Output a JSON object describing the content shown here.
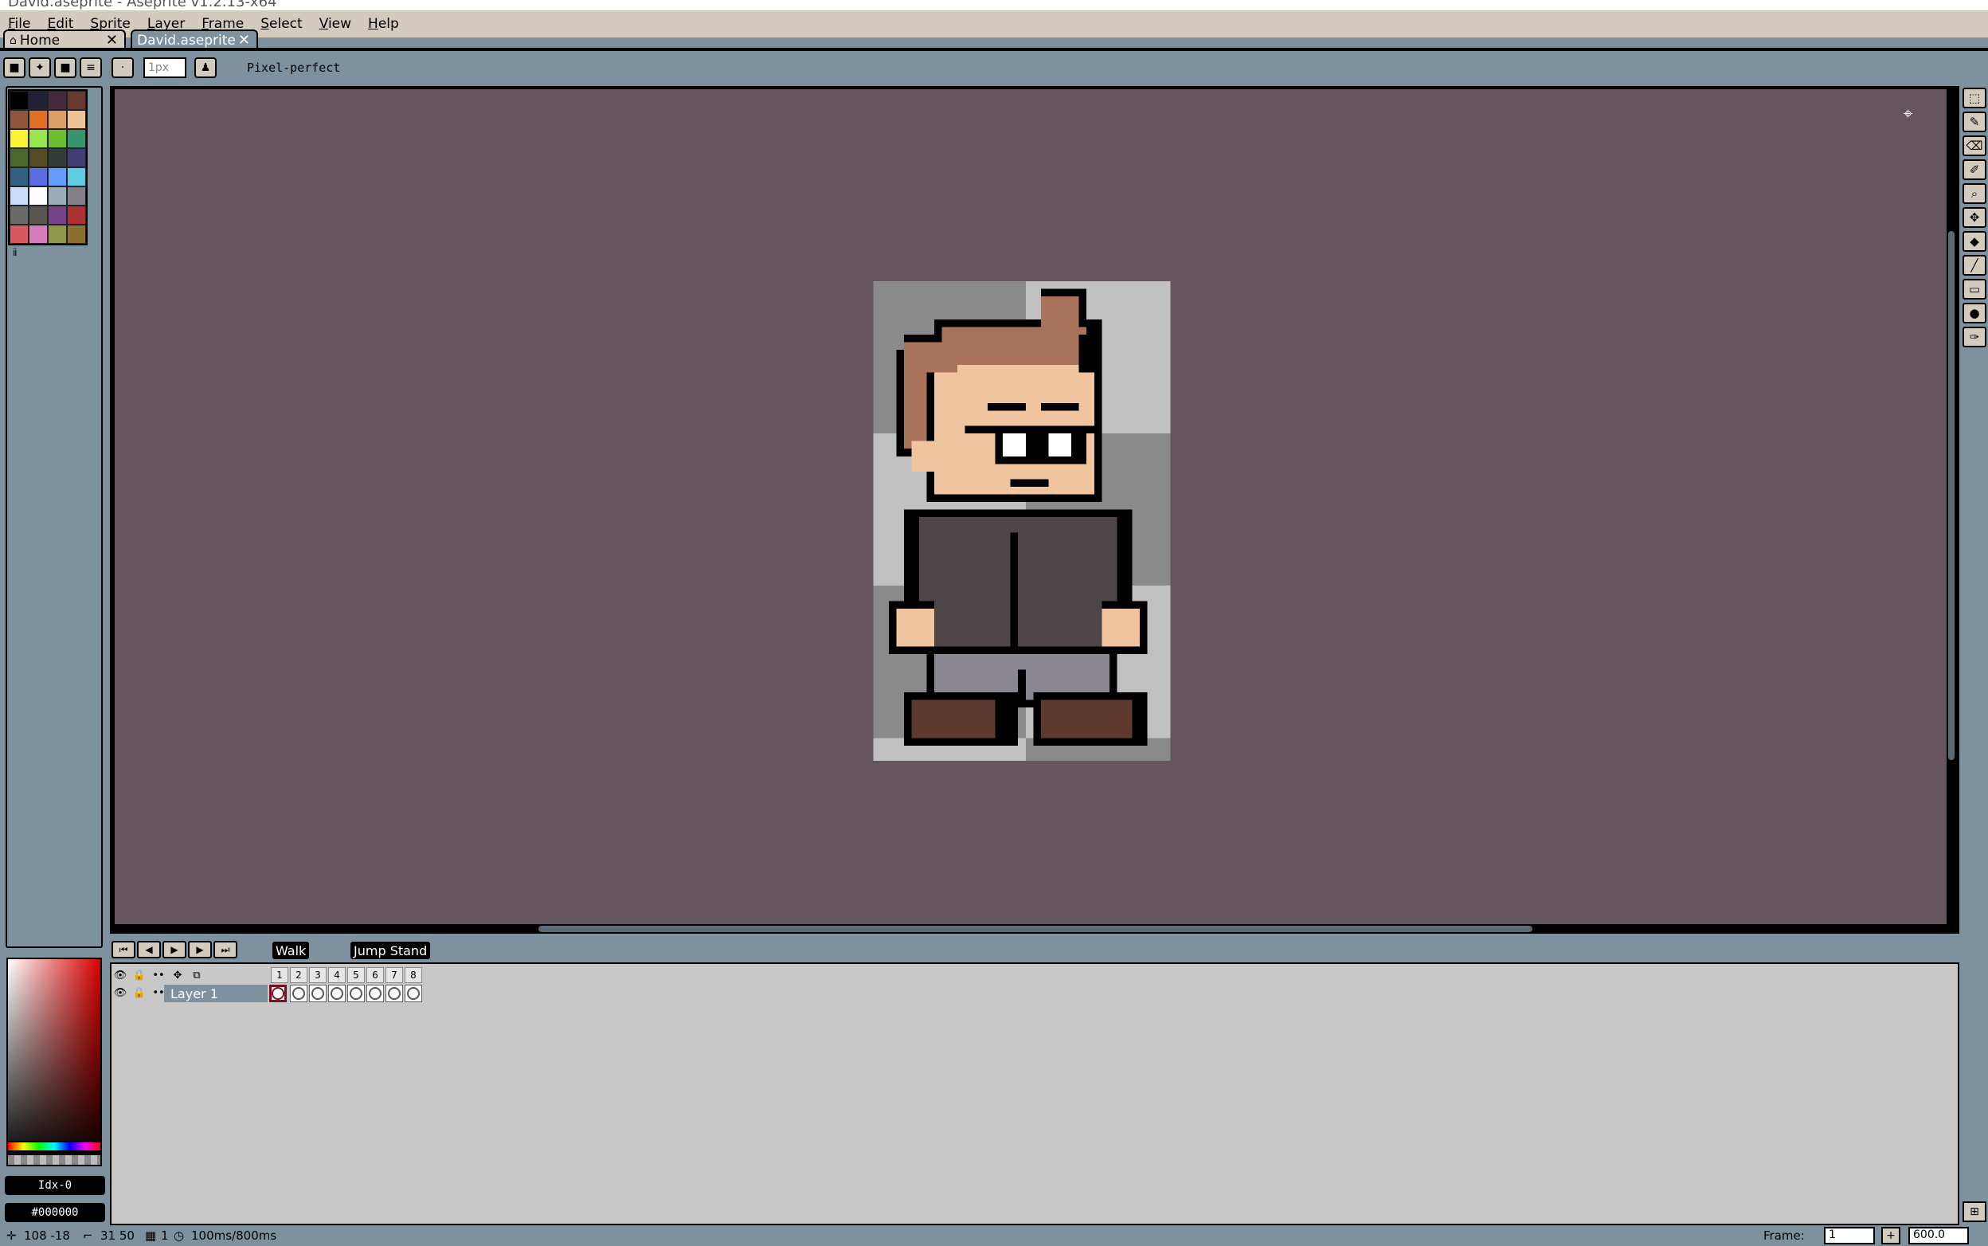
{
  "window": {
    "title": "David.aseprite - Aseprite v1.2.13-x64"
  },
  "menubar": {
    "items": [
      "File",
      "Edit",
      "Sprite",
      "Layer",
      "Frame",
      "Select",
      "View",
      "Help"
    ]
  },
  "tabs": [
    {
      "label": "Home",
      "icon": "home-icon",
      "close": "✕"
    },
    {
      "label": "David.aseprite",
      "close": "✕"
    }
  ],
  "toolbar": {
    "brush_size": "1px",
    "pixel_perfect_label": "Pixel-perfect"
  },
  "palette": {
    "colors": [
      "#000000",
      "#222034",
      "#45283c",
      "#663931",
      "#8f563b",
      "#df7126",
      "#d9a066",
      "#eec39a",
      "#fbf236",
      "#99e550",
      "#6abe30",
      "#37946e",
      "#4b692f",
      "#524b24",
      "#323c39",
      "#3f3f74",
      "#306082",
      "#5b6ee1",
      "#639bff",
      "#5fcde4",
      "#cbdbfc",
      "#ffffff",
      "#9badb7",
      "#847e87",
      "#696a6a",
      "#595652",
      "#76428a",
      "#ac3232",
      "#d95763",
      "#d77bba",
      "#8f974a",
      "#8a6f30"
    ]
  },
  "color_fields": {
    "index": "Idx-0",
    "hex": "#000000"
  },
  "timeline": {
    "tags": [
      "Walk",
      "Jump Stand"
    ],
    "frames": [
      "1",
      "2",
      "3",
      "4",
      "5",
      "6",
      "7",
      "8"
    ],
    "layer_name": "Layer 1"
  },
  "statusbar": {
    "cursor_pos": "108 -18",
    "selection_size": "31 50",
    "frame_info": "1",
    "duration": "100ms/800ms",
    "frame_label": "Frame:",
    "frame_value": "1",
    "zoom": "600.0"
  },
  "colors": {
    "accent": "#7d929e",
    "chrome": "#d3cbbe",
    "canvas_background": "#65555f"
  },
  "sprite": {
    "name": "David",
    "description_colors": {
      "hair": "#a8735a",
      "skin": "#f0c49e",
      "shirt": "#4e4549",
      "pants": "#8a8790",
      "shoes": "#5e3a2e",
      "outline": "#000000"
    }
  }
}
